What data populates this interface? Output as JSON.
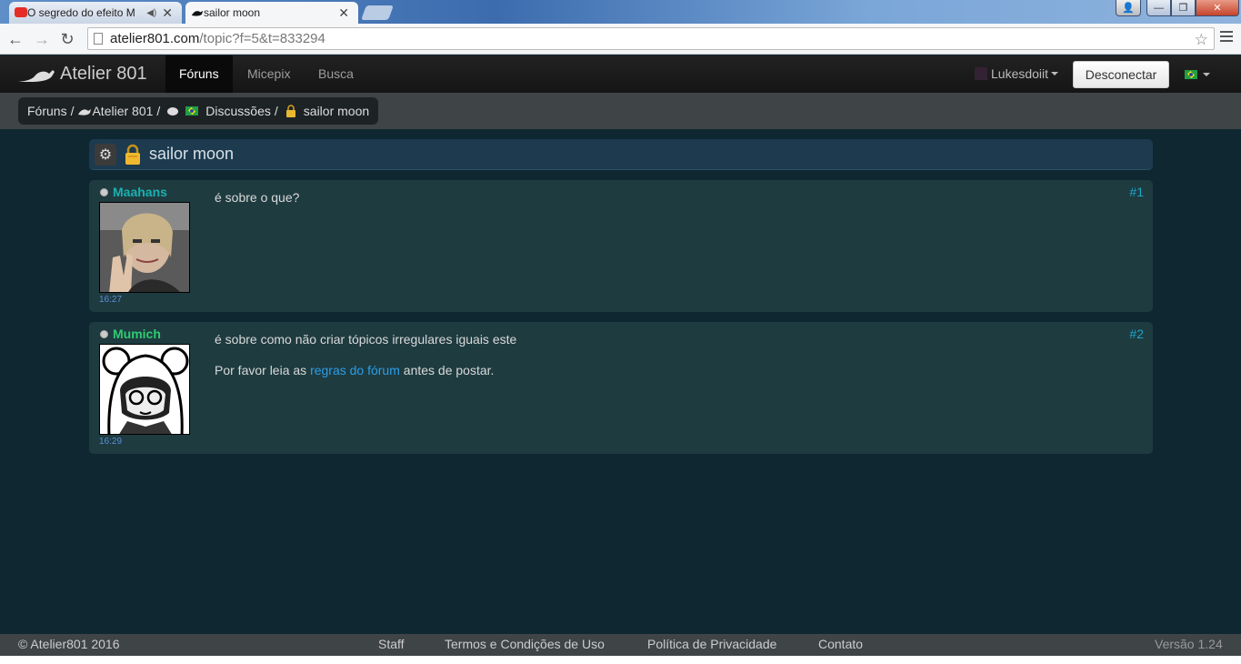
{
  "browser": {
    "tabs": [
      {
        "title": "O segredo do efeito M",
        "active": false
      },
      {
        "title": "sailor moon",
        "active": true
      }
    ],
    "url_domain": "atelier801.com",
    "url_path": "/topic?f=5&t=833294"
  },
  "site": {
    "brand": "Atelier 801",
    "nav": [
      "Fóruns",
      "Micepix",
      "Busca"
    ],
    "active_nav": "Fóruns",
    "username": "Lukesdoiit",
    "logout_label": "Desconectar"
  },
  "breadcrumb": {
    "forums": "Fóruns",
    "sep": "/",
    "atelier": "Atelier 801",
    "discussions": "Discussões",
    "topic": "sailor moon"
  },
  "topic": {
    "title": "sailor moon"
  },
  "posts": [
    {
      "author": "Maahans",
      "author_color": "#1bb0b0",
      "time": "16:27",
      "number": "#1",
      "text": "é sobre o que?"
    },
    {
      "author": "Mumich",
      "author_color": "#2ecc71",
      "time": "16:29",
      "number": "#2",
      "text": "é sobre como não criar tópicos irregulares iguais este",
      "notice_before": "Por favor leia as",
      "notice_link": "regras do fórum",
      "notice_after": "antes de postar."
    }
  ],
  "footer": {
    "copyright": "© Atelier801 2016",
    "links": [
      "Staff",
      "Termos e Condições de Uso",
      "Política de Privacidade",
      "Contato"
    ],
    "version": "Versão 1.24"
  },
  "colors": {
    "background": "#0f2731",
    "post_bg": "#1e3b40",
    "link": "#2c9ee6",
    "post_number": "#1aa6c8"
  }
}
